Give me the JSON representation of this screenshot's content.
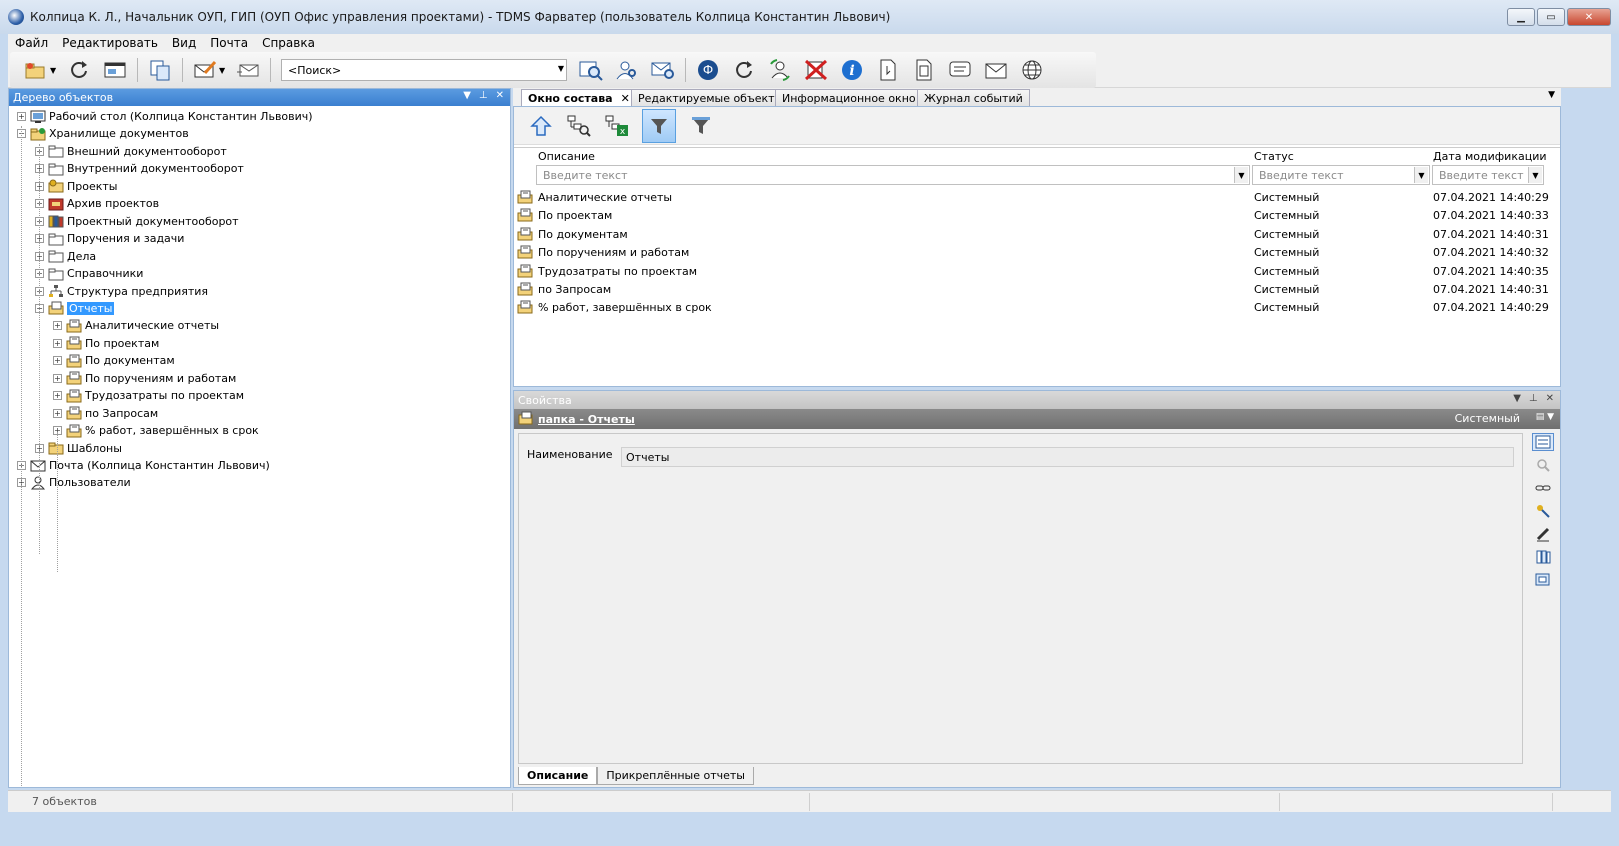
{
  "window": {
    "title": "Колпица К. Л., Начальник ОУП, ГИП (ОУП Офис управления проектами) - TDMS Фарватер (пользователь Колпица Константин Львович)",
    "controls": [
      "▁",
      "▭",
      "✕"
    ]
  },
  "menu": [
    "Файл",
    "Редактировать",
    "Вид",
    "Почта",
    "Справка"
  ],
  "toolbar": {
    "search_placeholder": "<Поиск>",
    "icons": [
      "new-folder-icon",
      "refresh-icon",
      "window-icon",
      "copy-object-icon",
      "compose-mail-icon",
      "send-mail-icon",
      "search-docs-icon",
      "user-search-icon",
      "mail-search-icon",
      "app-logo-icon",
      "reload-icon",
      "sync-users-icon",
      "delete-icon",
      "info-icon",
      "document-icon",
      "document-copy-icon",
      "message-icon",
      "envelope-icon",
      "globe-icon"
    ]
  },
  "tree": {
    "title": "Дерево объектов",
    "items": [
      {
        "label": "Рабочий стол (Колпица Константин Львович)",
        "icon": "desktop-icon",
        "level": 0
      },
      {
        "label": "Хранилище документов",
        "icon": "storage-icon",
        "level": 0,
        "expanded": true
      },
      {
        "label": "Внешний документооборот",
        "icon": "folder-icon",
        "level": 1
      },
      {
        "label": "Внутренний документооборот",
        "icon": "folder-icon",
        "level": 1
      },
      {
        "label": "Проекты",
        "icon": "projects-icon",
        "level": 1
      },
      {
        "label": "Архив проектов",
        "icon": "archive-icon",
        "level": 1
      },
      {
        "label": "Проектный документооборот",
        "icon": "books-icon",
        "level": 1
      },
      {
        "label": "Поручения и задачи",
        "icon": "folder-icon",
        "level": 1
      },
      {
        "label": "Дела",
        "icon": "folder-icon",
        "level": 1
      },
      {
        "label": "Справочники",
        "icon": "folder-icon",
        "level": 1
      },
      {
        "label": "Структура предприятия",
        "icon": "org-structure-icon",
        "level": 1
      },
      {
        "label": "Отчеты",
        "icon": "reports-folder-icon",
        "level": 1,
        "expanded": true,
        "selected": true
      },
      {
        "label": "Аналитические отчеты",
        "icon": "report-icon",
        "level": 2
      },
      {
        "label": "По проектам",
        "icon": "report-icon",
        "level": 2
      },
      {
        "label": "По документам",
        "icon": "report-icon",
        "level": 2
      },
      {
        "label": "По поручениям и работам",
        "icon": "report-icon",
        "level": 2
      },
      {
        "label": "Трудозатраты по проектам",
        "icon": "report-icon",
        "level": 2
      },
      {
        "label": "по Запросам",
        "icon": "report-icon",
        "level": 2
      },
      {
        "label": "% работ, завершённых в срок",
        "icon": "report-icon",
        "level": 2
      },
      {
        "label": "Шаблоны",
        "icon": "templates-icon",
        "level": 1
      },
      {
        "label": "Почта (Колпица Константин Львович)",
        "icon": "mail-icon",
        "level": 0
      },
      {
        "label": "Пользователи",
        "icon": "user-icon",
        "level": 0
      }
    ]
  },
  "tabs": [
    "Окно состава",
    "Редактируемые объекты",
    "Информационное окно",
    "Журнал событий"
  ],
  "grid": {
    "columns": [
      "Описание",
      "Статус",
      "Дата модификации"
    ],
    "filter_placeholder": "Введите текст",
    "rows": [
      {
        "description": "Аналитические отчеты",
        "status": "Системный",
        "date": "07.04.2021 14:40:29"
      },
      {
        "description": "По проектам",
        "status": "Системный",
        "date": "07.04.2021 14:40:33"
      },
      {
        "description": "По документам",
        "status": "Системный",
        "date": "07.04.2021 14:40:31"
      },
      {
        "description": "По поручениям и работам",
        "status": "Системный",
        "date": "07.04.2021 14:40:32"
      },
      {
        "description": "Трудозатраты по проектам",
        "status": "Системный",
        "date": "07.04.2021 14:40:35"
      },
      {
        "description": "по Запросам",
        "status": "Системный",
        "date": "07.04.2021 14:40:31"
      },
      {
        "description": "% работ, завершённых в срок",
        "status": "Системный",
        "date": "07.04.2021 14:40:29"
      }
    ]
  },
  "properties": {
    "title": "Свойства",
    "object_title": "папка - Отчеты",
    "object_status": "Системный",
    "field_label": "Наименование",
    "field_value": "Отчеты",
    "tabs": [
      "Описание",
      "Прикреплённые отчеты"
    ]
  },
  "status": {
    "count": "7 объектов"
  },
  "colors": {
    "panel_header": "#3a7fd0",
    "selection": "#3399ff",
    "props_header": "#707070"
  }
}
